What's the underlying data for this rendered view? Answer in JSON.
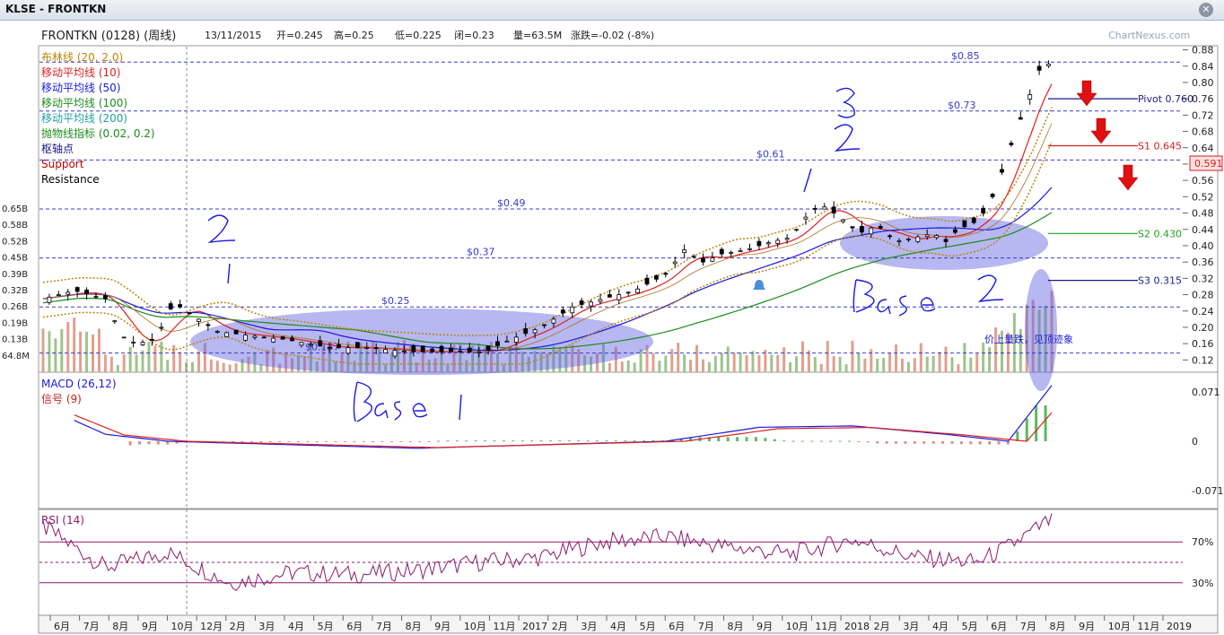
{
  "window": {
    "title": "KLSE - FRONTKN",
    "close_icon": "close-icon"
  },
  "watermark": "ChartNexus.com",
  "header": {
    "stock": "FRONTKN (0128) (周线)",
    "date": "13/11/2015",
    "open": "开=0.245",
    "high": "高=0.25",
    "low": "低=0.225",
    "close": "闭=0.23",
    "volume": "量=63.5M",
    "change": "涨跌=-0.02 (-8%)"
  },
  "legend": [
    {
      "text": "布林线 (20, 2.0)",
      "color": "#b8860b"
    },
    {
      "text": "移动平均线 (10)",
      "color": "#e02020"
    },
    {
      "text": "移动平均线 (50)",
      "color": "#1a1ae0"
    },
    {
      "text": "移动平均线 (100)",
      "color": "#1a8c1a"
    },
    {
      "text": "移动平均线 (200)",
      "color": "#20a0a0"
    },
    {
      "text": "抛物线指标 (0.02, 0.2)",
      "color": "#1a8c1a"
    },
    {
      "text": "枢轴点",
      "color": "#1a1a8c"
    },
    {
      "text": "Support",
      "color": "#c00000"
    },
    {
      "text": "Resistance",
      "color": "#000000"
    }
  ],
  "chart_data": [
    {
      "type": "candlestick",
      "title": "FRONTKN (0128) (周线)",
      "y_ticks": [
        "0.88",
        "0.84",
        "0.80",
        "0.76",
        "0.72",
        "0.68",
        "0.64",
        "0.60",
        "0.56",
        "0.52",
        "0.48",
        "0.44",
        "0.40",
        "0.36",
        "0.32",
        "0.28",
        "0.24",
        "0.20",
        "0.16",
        "0.12"
      ],
      "ylim": [
        0.09,
        0.89
      ],
      "volume_ticks": [
        "0.65B",
        "0.58B",
        "0.52B",
        "0.45B",
        "0.39B",
        "0.32B",
        "0.26B",
        "0.19B",
        "0.13B",
        "64.8M"
      ],
      "x_labels": [
        "6月",
        "7月",
        "8月",
        "9月",
        "10月",
        "12月",
        "2月",
        "3月",
        "4月",
        "5月",
        "6月",
        "7月",
        "8月",
        "9月",
        "10月",
        "11月",
        "2017",
        "2月",
        "3月",
        "4月",
        "5月",
        "6月",
        "7月",
        "8月",
        "9月",
        "10月",
        "11月",
        "2018",
        "2月",
        "3月",
        "4月",
        "5月",
        "6月",
        "7月",
        "8月",
        "9月",
        "10月",
        "11月",
        "2019"
      ],
      "price_path": [
        [
          0,
          0.27
        ],
        [
          10,
          0.29
        ],
        [
          20,
          0.27
        ],
        [
          25,
          0.18
        ],
        [
          30,
          0.16
        ],
        [
          36,
          0.17
        ],
        [
          42,
          0.26
        ],
        [
          48,
          0.23
        ],
        [
          56,
          0.19
        ],
        [
          66,
          0.18
        ],
        [
          78,
          0.17
        ],
        [
          92,
          0.15
        ],
        [
          104,
          0.15
        ],
        [
          118,
          0.14
        ],
        [
          132,
          0.14
        ],
        [
          142,
          0.14
        ],
        [
          150,
          0.17
        ],
        [
          160,
          0.2
        ],
        [
          170,
          0.25
        ],
        [
          180,
          0.27
        ],
        [
          190,
          0.29
        ],
        [
          200,
          0.33
        ],
        [
          206,
          0.39
        ],
        [
          212,
          0.36
        ],
        [
          218,
          0.38
        ],
        [
          226,
          0.39
        ],
        [
          234,
          0.41
        ],
        [
          240,
          0.42
        ],
        [
          246,
          0.48
        ],
        [
          250,
          0.5
        ],
        [
          256,
          0.47
        ],
        [
          262,
          0.43
        ],
        [
          268,
          0.45
        ],
        [
          274,
          0.41
        ],
        [
          280,
          0.42
        ],
        [
          286,
          0.43
        ],
        [
          290,
          0.41
        ],
        [
          294,
          0.44
        ],
        [
          300,
          0.46
        ],
        [
          304,
          0.5
        ],
        [
          308,
          0.58
        ],
        [
          312,
          0.67
        ],
        [
          316,
          0.75
        ],
        [
          320,
          0.83
        ],
        [
          324,
          0.85
        ]
      ],
      "dashed_levels": [
        {
          "label": "$0.85",
          "value": 0.85
        },
        {
          "label": "$0.73",
          "value": 0.73
        },
        {
          "label": "$0.61",
          "value": 0.61
        },
        {
          "label": "$0.49",
          "value": 0.49
        },
        {
          "label": "$0.37",
          "value": 0.37
        },
        {
          "label": "$0.25",
          "value": 0.25
        },
        {
          "label": "$0.137",
          "value": 0.137
        }
      ],
      "pivots": [
        {
          "label": "Pivot 0.760",
          "value": 0.76,
          "color": "#1a1a8c"
        },
        {
          "label": "S1 0.645",
          "value": 0.645,
          "color": "#d02020"
        },
        {
          "label": "S2 0.430",
          "value": 0.43,
          "color": "#20a020"
        },
        {
          "label": "S3 0.315",
          "value": 0.315,
          "color": "#1a1a8c"
        }
      ],
      "last_price": "0.591",
      "last_price_value": 0.591
    },
    {
      "type": "bar",
      "title": "MACD (26,12)",
      "signal_label": "信号 (9)",
      "y_ticks": [
        "0.071",
        "0",
        "-0.071"
      ],
      "ylim": [
        -0.09,
        0.09
      ],
      "macd_path": [
        [
          0,
          0.05
        ],
        [
          20,
          0.01
        ],
        [
          40,
          0.0
        ],
        [
          80,
          -0.005
        ],
        [
          120,
          -0.01
        ],
        [
          160,
          -0.005
        ],
        [
          200,
          0.0
        ],
        [
          230,
          0.02
        ],
        [
          260,
          0.022
        ],
        [
          290,
          0.01
        ],
        [
          310,
          0.0
        ],
        [
          324,
          0.08
        ]
      ]
    },
    {
      "type": "line",
      "title": "RSI (14)",
      "y_ticks": [
        "70%",
        "30%"
      ],
      "ylim": [
        0,
        100
      ],
      "rsi_path": [
        [
          0,
          85
        ],
        [
          20,
          45
        ],
        [
          40,
          60
        ],
        [
          60,
          30
        ],
        [
          80,
          40
        ],
        [
          100,
          38
        ],
        [
          120,
          42
        ],
        [
          140,
          50
        ],
        [
          160,
          55
        ],
        [
          180,
          70
        ],
        [
          200,
          75
        ],
        [
          220,
          65
        ],
        [
          240,
          58
        ],
        [
          260,
          72
        ],
        [
          280,
          55
        ],
        [
          300,
          50
        ],
        [
          310,
          65
        ],
        [
          324,
          92
        ]
      ]
    }
  ],
  "annotations": {
    "base1": "Base 1",
    "base2": "Base 2",
    "n2_left": "2",
    "n1_left": "1",
    "n1_mid": "1",
    "n2_mid": "2",
    "n3_mid": "3",
    "volume_note": "价上量跌，见顶迹象"
  }
}
